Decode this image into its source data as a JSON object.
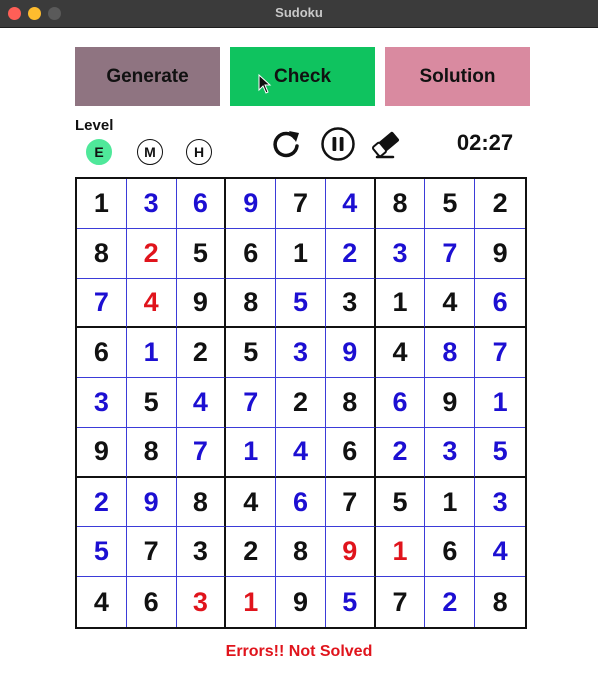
{
  "window": {
    "title": "Sudoku"
  },
  "buttons": {
    "generate": "Generate",
    "check": "Check",
    "solution": "Solution"
  },
  "level": {
    "label": "Level",
    "options": [
      "E",
      "M",
      "H"
    ],
    "selected": "E"
  },
  "timer": "02:27",
  "status": "Errors!! Not Solved",
  "colors": {
    "given": "#111111",
    "user": "#1c0fd2",
    "error": "#e0141c",
    "check_button": "#0fc35f",
    "generate_button": "#8f7481",
    "solution_button": "#d98aa0",
    "level_selected": "#4fe89a"
  },
  "grid": {
    "values": [
      [
        1,
        3,
        6,
        9,
        7,
        4,
        8,
        5,
        2
      ],
      [
        8,
        2,
        5,
        6,
        1,
        2,
        3,
        7,
        9
      ],
      [
        7,
        4,
        9,
        8,
        5,
        3,
        1,
        4,
        6
      ],
      [
        6,
        1,
        2,
        5,
        3,
        9,
        4,
        8,
        7
      ],
      [
        3,
        5,
        4,
        7,
        2,
        8,
        6,
        9,
        1
      ],
      [
        9,
        8,
        7,
        1,
        4,
        6,
        2,
        3,
        5
      ],
      [
        2,
        9,
        8,
        4,
        6,
        7,
        5,
        1,
        3
      ],
      [
        5,
        7,
        3,
        2,
        8,
        9,
        1,
        6,
        4
      ],
      [
        4,
        6,
        3,
        1,
        9,
        5,
        7,
        2,
        8
      ]
    ],
    "kinds": [
      [
        "g",
        "u",
        "u",
        "u",
        "g",
        "u",
        "g",
        "g",
        "g"
      ],
      [
        "g",
        "e",
        "g",
        "g",
        "g",
        "u",
        "u",
        "u",
        "g"
      ],
      [
        "u",
        "e",
        "g",
        "g",
        "u",
        "g",
        "g",
        "g",
        "u"
      ],
      [
        "g",
        "u",
        "g",
        "g",
        "u",
        "u",
        "g",
        "u",
        "u"
      ],
      [
        "u",
        "g",
        "u",
        "u",
        "g",
        "g",
        "u",
        "g",
        "u"
      ],
      [
        "g",
        "g",
        "u",
        "u",
        "u",
        "g",
        "u",
        "u",
        "u"
      ],
      [
        "u",
        "u",
        "g",
        "g",
        "u",
        "g",
        "g",
        "g",
        "u"
      ],
      [
        "u",
        "g",
        "g",
        "g",
        "g",
        "e",
        "e",
        "g",
        "u"
      ],
      [
        "g",
        "g",
        "e",
        "e",
        "g",
        "u",
        "g",
        "u",
        "g"
      ]
    ]
  }
}
